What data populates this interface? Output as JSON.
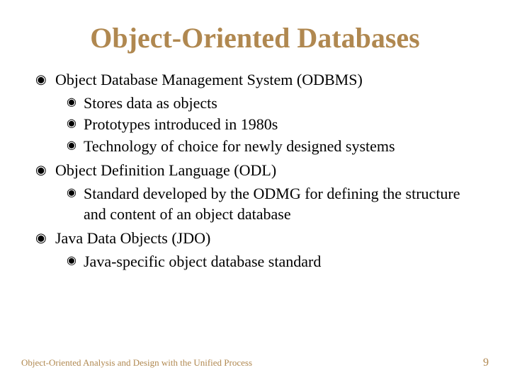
{
  "title": "Object-Oriented Databases",
  "items": [
    {
      "text": "Object Database Management System (ODBMS)",
      "children": [
        {
          "text": "Stores data as objects"
        },
        {
          "text": "Prototypes introduced in 1980s"
        },
        {
          "text": "Technology of choice for newly designed systems"
        }
      ]
    },
    {
      "text": "Object Definition Language (ODL)",
      "children": [
        {
          "text": "Standard developed by the ODMG for defining the structure and content of an object database"
        }
      ]
    },
    {
      "text": "Java Data Objects (JDO)",
      "children": [
        {
          "text": " Java-specific object database standard"
        }
      ]
    }
  ],
  "footer": {
    "left": "Object-Oriented Analysis and Design with the Unified Process",
    "right": "9"
  },
  "bullet_glyph": "◉"
}
